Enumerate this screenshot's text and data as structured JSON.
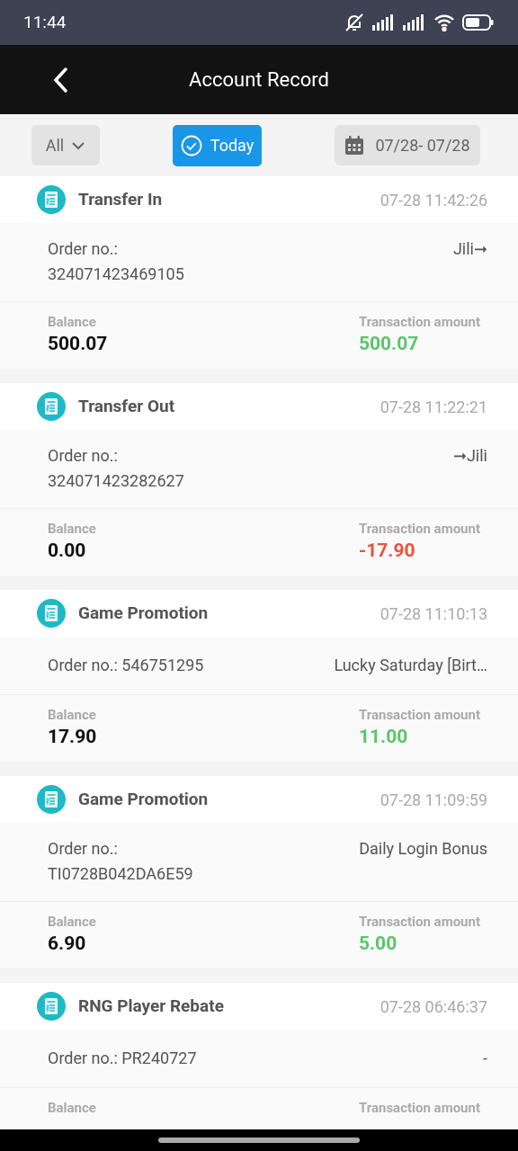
{
  "status_bar": {
    "time": "11:44"
  },
  "header": {
    "title": "Account Record"
  },
  "filters": {
    "type": {
      "label": "All"
    },
    "today": {
      "label": "Today",
      "selected": true
    },
    "date_range": {
      "label": "07/28- 07/28"
    }
  },
  "records": [
    {
      "title": "Transfer In",
      "time": "07-28 11:42:26",
      "order_label": "Order no.:",
      "order_no": "324071423469105",
      "kind": "stacked",
      "detail": "Jili➞",
      "balance_label": "Balance",
      "balance": "500.07",
      "amount_label": "Transaction amount",
      "amount": "500.07",
      "color": "#5cc46a"
    },
    {
      "title": "Transfer Out",
      "time": "07-28 11:22:21",
      "order_label": "Order no.:",
      "order_no": "324071423282627",
      "kind": "stacked",
      "detail": "➞Jili",
      "balance_label": "Balance",
      "balance": "0.00",
      "amount_label": "Transaction amount",
      "amount": "-17.90",
      "color": "#e8533d"
    },
    {
      "title": "Game Promotion",
      "time": "07-28 11:10:13",
      "order_label": "Order no.:",
      "order_no": "546751295",
      "kind": "inline",
      "detail": "Lucky Saturday [Birt…",
      "balance_label": "Balance",
      "balance": "17.90",
      "amount_label": "Transaction amount",
      "amount": "11.00",
      "color": "#5cc46a"
    },
    {
      "title": "Game Promotion",
      "time": "07-28 11:09:59",
      "order_label": "Order no.:",
      "order_no": "TI0728B042DA6E59",
      "kind": "stacked",
      "detail": "Daily Login Bonus",
      "balance_label": "Balance",
      "balance": "6.90",
      "amount_label": "Transaction amount",
      "amount": "5.00",
      "color": "#5cc46a"
    },
    {
      "title": "RNG Player Rebate",
      "time": "07-28 06:46:37",
      "order_label": "Order no.:",
      "order_no": "PR240727",
      "kind": "inline",
      "detail": "-",
      "balance_label": "Balance",
      "amount_label": "Transaction amount"
    }
  ]
}
